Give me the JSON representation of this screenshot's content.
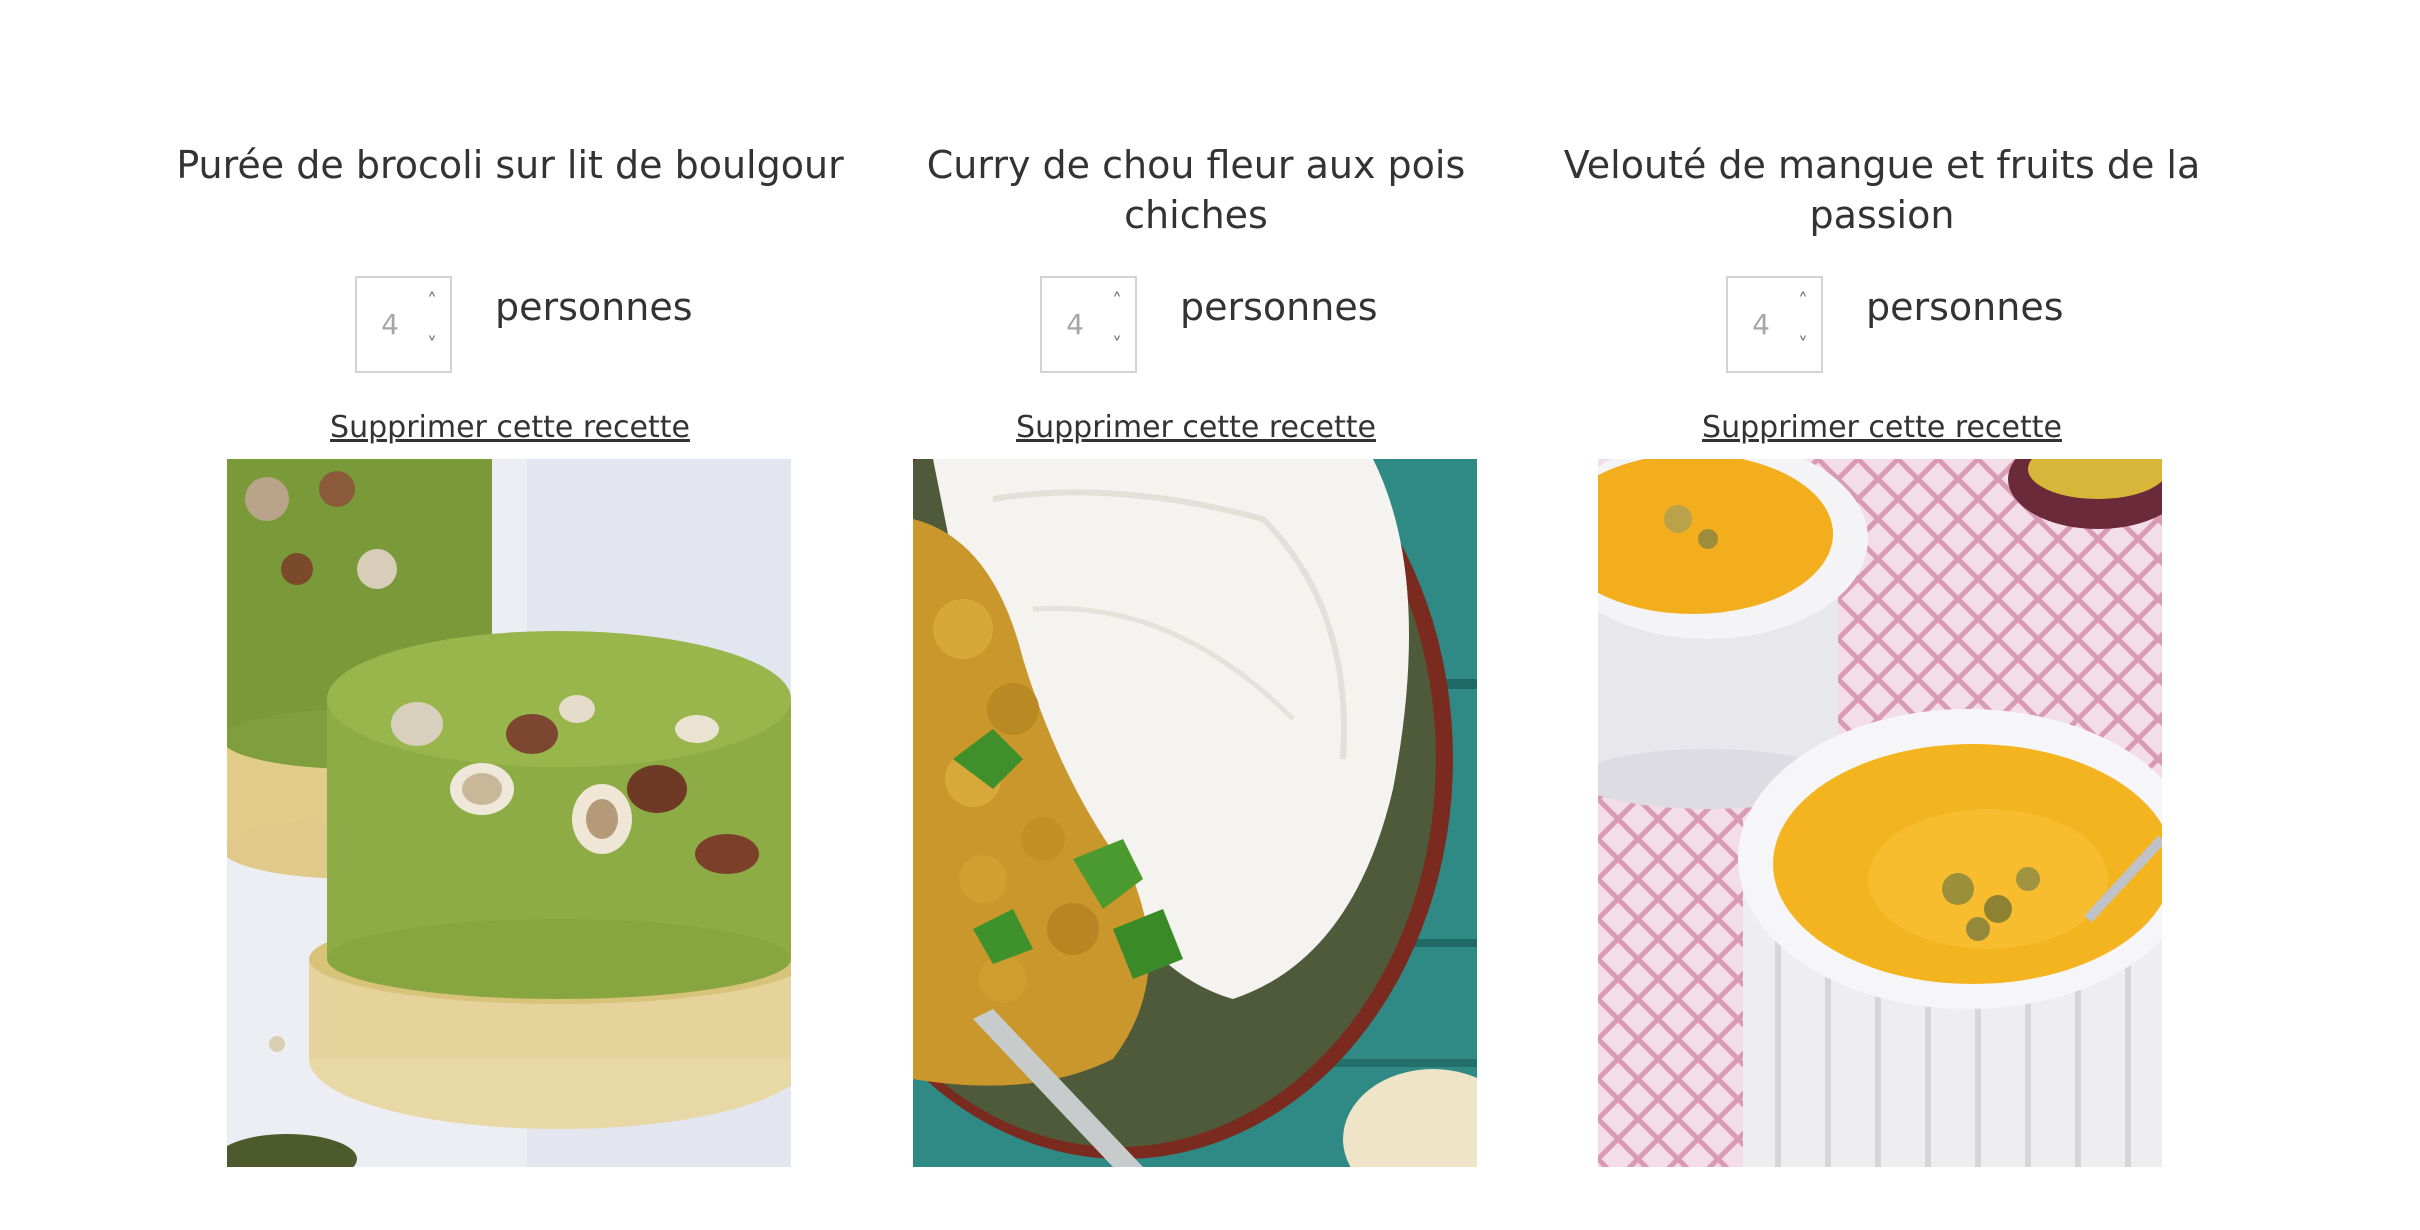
{
  "recipes": [
    {
      "title": "Purée de brocoli sur lit de boulgour",
      "servings_value": "4",
      "servings_label": "personnes",
      "delete_label": "Supprimer cette recette",
      "photo_subject": "broccoli purée rounds topped with hazelnuts on bulgur"
    },
    {
      "title": "Curry de chou fleur aux pois chiches",
      "servings_value": "4",
      "servings_label": "personnes",
      "delete_label": "Supprimer cette recette",
      "photo_subject": "cauliflower chickpea curry with white rice in a bowl"
    },
    {
      "title": "Velouté de mangue et fruits de la passion",
      "servings_value": "4",
      "servings_label": "personnes",
      "delete_label": "Supprimer cette recette",
      "photo_subject": "mango and passion fruit velouté in white ramekins"
    }
  ],
  "spinner": {
    "up_icon": "chevron-up-icon",
    "down_icon": "chevron-down-icon"
  },
  "colors": {
    "text": "#333333",
    "input_border": "#d3d3d3",
    "input_value": "#a6a6a6"
  }
}
